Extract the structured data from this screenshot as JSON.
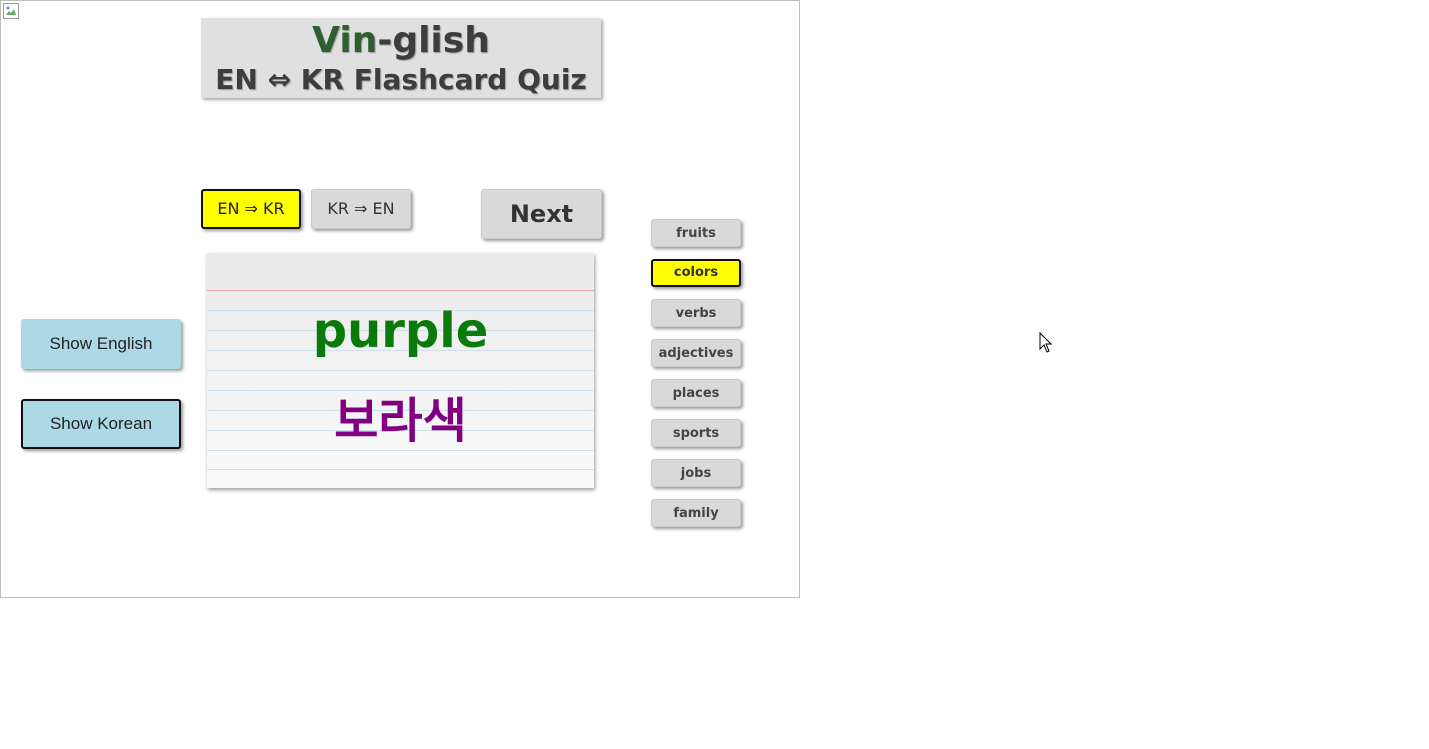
{
  "title": {
    "line1_highlight": "Vin",
    "line1_rest": "-glish",
    "line2": "EN ⇔ KR Flashcard Quiz"
  },
  "mode_buttons": {
    "en_to_kr": "EN ⇒ KR",
    "kr_to_en": "KR ⇒ EN",
    "selected": "en_to_kr"
  },
  "next_label": "Next",
  "side_buttons": {
    "show_english": "Show English",
    "show_korean": "Show Korean"
  },
  "card": {
    "english": "purple",
    "korean": "보라색"
  },
  "categories": [
    {
      "label": "fruits",
      "selected": false
    },
    {
      "label": "colors",
      "selected": true
    },
    {
      "label": "verbs",
      "selected": false
    },
    {
      "label": "adjectives",
      "selected": false
    },
    {
      "label": "places",
      "selected": false
    },
    {
      "label": "sports",
      "selected": false
    },
    {
      "label": "jobs",
      "selected": false
    },
    {
      "label": "family",
      "selected": false
    }
  ],
  "icons": {
    "broken_image": "broken-image-icon",
    "cursor": "mouse-pointer-icon"
  },
  "colors": {
    "selected_button": "#ffff00",
    "side_button": "#add8e6",
    "english_word": "#0a7a0a",
    "korean_word": "#800080",
    "title_box": "#e0e0e0"
  }
}
